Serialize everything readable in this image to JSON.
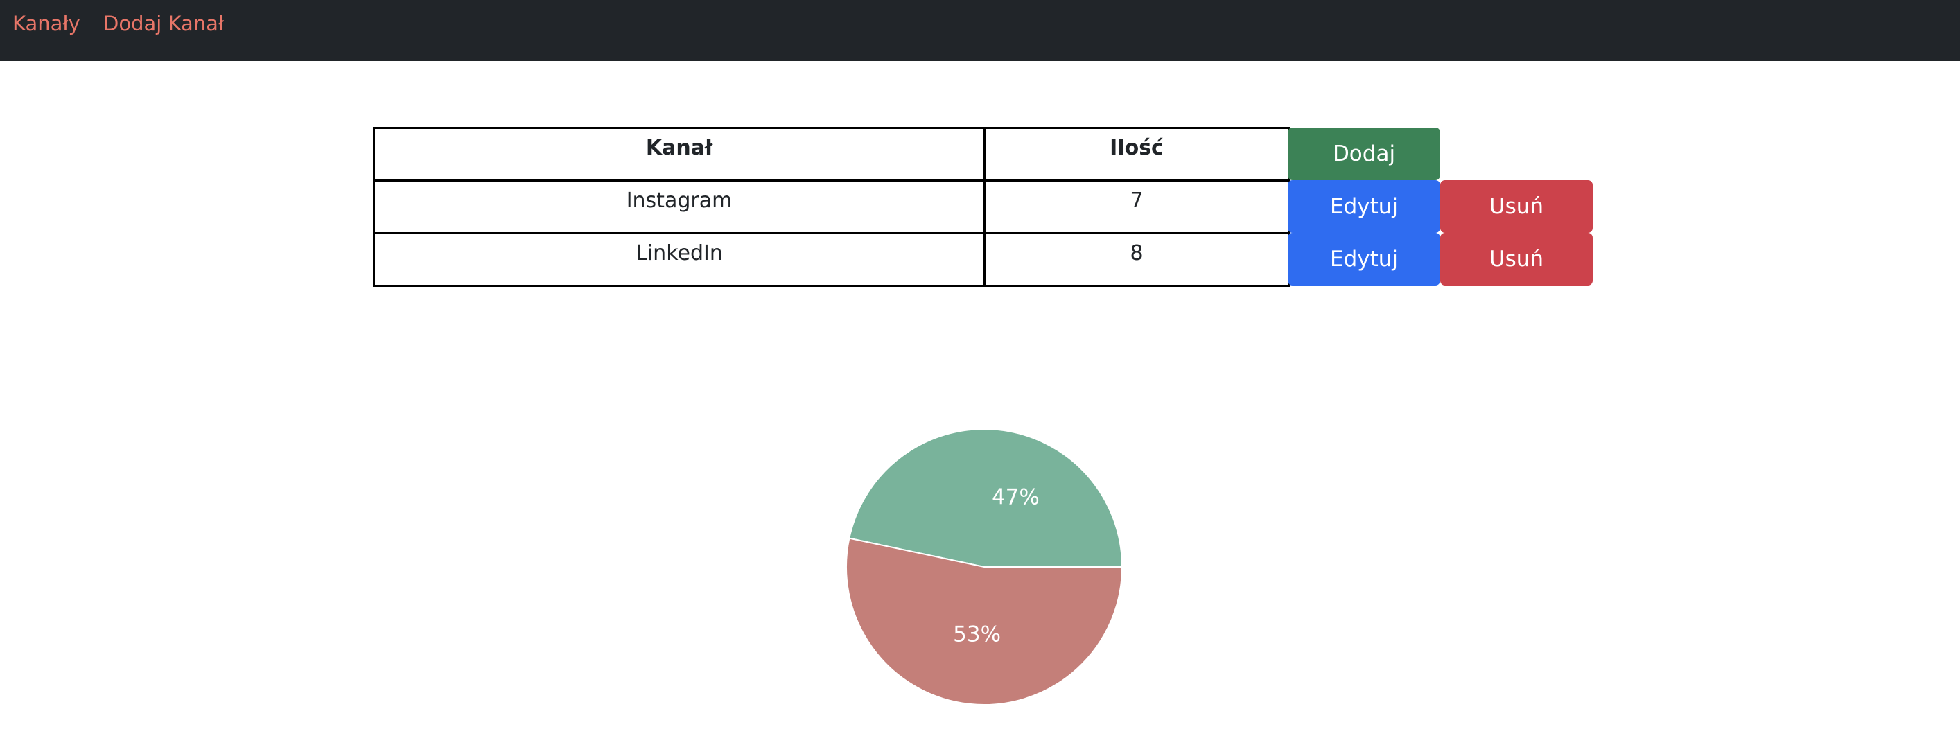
{
  "nav": {
    "items": [
      {
        "label": "Kanały"
      },
      {
        "label": "Dodaj Kanał"
      }
    ]
  },
  "table": {
    "headers": [
      "Kanał",
      "Ilość"
    ],
    "rows": [
      {
        "kanal": "Instagram",
        "ilosc": "7"
      },
      {
        "kanal": "LinkedIn",
        "ilosc": "8"
      }
    ],
    "add_label": "Dodaj",
    "edit_label": "Edytuj",
    "delete_label": "Usuń"
  },
  "colors": {
    "nav_bg": "#212529",
    "nav_link": "#e87668",
    "add_button": "#3c8256",
    "edit_button": "#2f6cf0",
    "delete_button": "#cc424b"
  },
  "chart_data": {
    "type": "pie",
    "categories": [
      "Instagram",
      "LinkedIn"
    ],
    "values": [
      7,
      8
    ],
    "labels": [
      "47%",
      "53%"
    ],
    "colors": [
      "#79b39b",
      "#c47f79"
    ],
    "legend": "none"
  }
}
